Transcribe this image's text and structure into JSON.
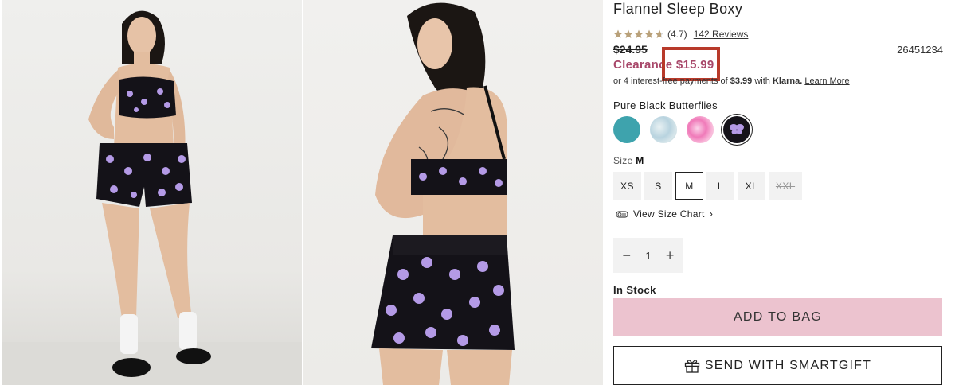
{
  "product": {
    "title": "Flannel Sleep Boxy",
    "rating": "(4.7)",
    "reviews_label": "142 Reviews",
    "original_price": "$24.95",
    "sku": "26451234",
    "clearance_label": "Clearance",
    "clearance_price": "$15.99",
    "klarna": {
      "prefix": "or 4 interest-free payments of",
      "amount": "$3.99",
      "with": "with",
      "brand": "Klarna.",
      "learn_more": "Learn More"
    }
  },
  "color": {
    "selected_name": "Pure Black Butterflies",
    "swatches": [
      {
        "name": "teal",
        "color": "#3ea3ad"
      },
      {
        "name": "blue-tie-dye",
        "color": "#c9dde6"
      },
      {
        "name": "pink-tie-dye",
        "color": "#f08cc2"
      },
      {
        "name": "pure-black-butterflies",
        "color": "#15131a"
      }
    ]
  },
  "size": {
    "label": "Size",
    "selected": "M",
    "options": [
      "XS",
      "S",
      "M",
      "L",
      "XL",
      "XXL"
    ]
  },
  "size_chart_label": "View Size Chart",
  "quantity": {
    "value": "1",
    "minus": "−",
    "plus": "+"
  },
  "stock_status": "In Stock",
  "buttons": {
    "add_to_bag": "ADD TO BAG",
    "smartgift": "SEND WITH SMARTGIFT"
  },
  "colors": {
    "clearance": "#a8486a",
    "add_to_bag_bg": "#ecc3cf",
    "highlight": "#b83a2a"
  }
}
